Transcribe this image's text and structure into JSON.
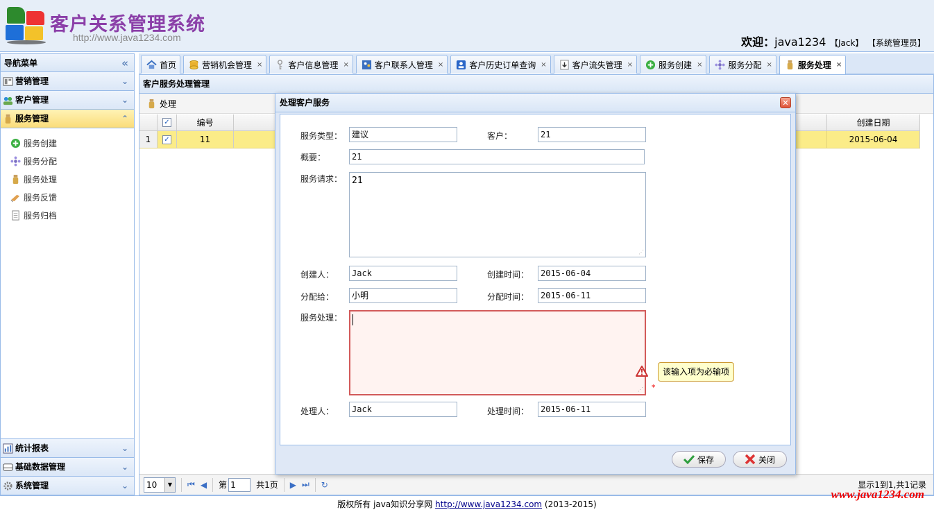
{
  "header": {
    "app_title": "客户关系管理系统",
    "url": "http://www.java1234.com",
    "welcome_prefix": "欢迎：",
    "username": "java1234",
    "user_real": "【Jack】",
    "user_role": "【系统管理员】"
  },
  "nav": {
    "title": "导航菜单",
    "collapse_glyph": "«",
    "sections_top": [
      {
        "label": "营销管理",
        "icon": "marketing-icon"
      },
      {
        "label": "客户管理",
        "icon": "customers-icon"
      },
      {
        "label": "服务管理",
        "icon": "service-icon"
      }
    ],
    "service_items": [
      {
        "label": "服务创建",
        "icon": "add-circle-icon"
      },
      {
        "label": "服务分配",
        "icon": "assign-icon"
      },
      {
        "label": "服务处理",
        "icon": "process-icon"
      },
      {
        "label": "服务反馈",
        "icon": "feedback-icon"
      },
      {
        "label": "服务归档",
        "icon": "archive-icon"
      }
    ],
    "sections_bottom": [
      {
        "label": "统计报表",
        "icon": "chart-icon"
      },
      {
        "label": "基础数据管理",
        "icon": "database-icon"
      },
      {
        "label": "系统管理",
        "icon": "gear-icon"
      }
    ]
  },
  "tabs": [
    {
      "label": "首页",
      "icon": "home-icon",
      "closable": false
    },
    {
      "label": "营销机会管理",
      "icon": "coins-icon",
      "closable": true
    },
    {
      "label": "客户信息管理",
      "icon": "key-icon",
      "closable": true
    },
    {
      "label": "客户联系人管理",
      "icon": "contacts-icon",
      "closable": true
    },
    {
      "label": "客户历史订单查询",
      "icon": "order-icon",
      "closable": true
    },
    {
      "label": "客户流失管理",
      "icon": "loss-icon",
      "closable": true
    },
    {
      "label": "服务创建",
      "icon": "add-circle-icon",
      "closable": true
    },
    {
      "label": "服务分配",
      "icon": "assign-icon",
      "closable": true
    },
    {
      "label": "服务处理",
      "icon": "process-icon",
      "closable": true,
      "active": true
    }
  ],
  "close_glyph": "×",
  "panel": {
    "title": "客户服务处理管理",
    "toolbar_label": "处理",
    "columns": {
      "id": "编号",
      "created": "创建日期"
    },
    "row": {
      "index": "1",
      "id": "11",
      "created": "2015-06-04",
      "checked": "✓"
    },
    "header_checked": "✓"
  },
  "pager": {
    "page_size": "10",
    "page_prefix": "第",
    "page_value": "1",
    "page_suffix": "共1页",
    "info": "显示1到1,共1记录"
  },
  "dialog": {
    "title": "处理客户服务",
    "close_glyph": "✕",
    "labels": {
      "service_type": "服务类型：",
      "customer": "客户：",
      "summary": "概要：",
      "request": "服务请求：",
      "creator": "创建人：",
      "create_time": "创建时间：",
      "assignee": "分配给：",
      "assign_time": "分配时间：",
      "handling": "服务处理：",
      "handler": "处理人：",
      "handle_time": "处理时间："
    },
    "values": {
      "service_type": "建议",
      "customer": "21",
      "summary": "21",
      "request": "21",
      "creator": "Jack",
      "create_time": "2015-06-04",
      "assignee": "小明",
      "assign_time": "2015-06-11",
      "handling": "",
      "handler": "Jack",
      "handle_time": "2015-06-11"
    },
    "validation_tip": "该输入项为必输项",
    "required_mark": "*",
    "buttons": {
      "save": "保存",
      "close": "关闭"
    }
  },
  "footer": {
    "text_prefix": "版权所有 java知识分享网 ",
    "link": "http://www.java1234.com",
    "text_suffix": " (2013-2015)",
    "watermark": "www.java1234.com"
  }
}
